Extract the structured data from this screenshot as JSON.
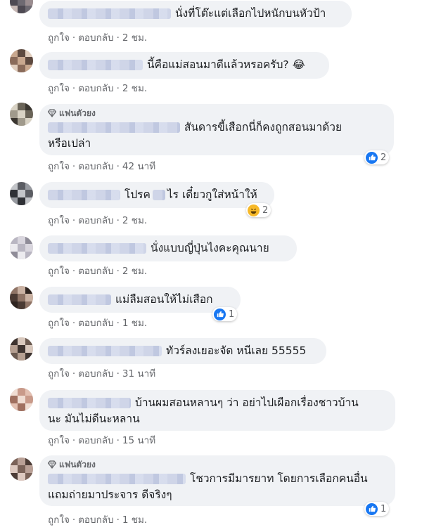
{
  "actions": {
    "like": "ถูกใจ",
    "reply": "ตอบกลับ",
    "dot": "·"
  },
  "badge_label": "แฟนตัวยง",
  "comments": [
    {
      "lines": [
        "นั่งที่โต๊ะแต่เลือกไปหนักบนหัวป้า"
      ],
      "time": "2 ชม."
    },
    {
      "lines": [
        "นี้คือแม่สอนมาดีแล้วหรอครับ?"
      ],
      "emoji": "😂",
      "time": "2 ชม."
    },
    {
      "lines": [
        "สันดารขี้เสือกนี่ก็คงถูกสอนมาด้วย",
        "หรือเปล่า"
      ],
      "time": "42 นาที",
      "reaction": {
        "type": "like",
        "count": "2"
      }
    },
    {
      "lines": [
        "โปรค",
        "ไร เดี๋ยวกูใส่หน้าให้"
      ],
      "time": "2 ชม.",
      "reaction": {
        "type": "haha",
        "count": "2"
      }
    },
    {
      "lines": [
        "นั่งแบบญี่ปุ่นไงคะคุณนาย"
      ],
      "time": "2 ชม."
    },
    {
      "lines": [
        "แม่ลืมสอนให้ไม่เสือก"
      ],
      "time": "1 ชม.",
      "reaction": {
        "type": "like",
        "count": "1"
      }
    },
    {
      "lines": [
        "ทัวร์ลงเยอะจัด หนีเลย 55555"
      ],
      "time": "31 นาที"
    },
    {
      "lines": [
        "บ้านผมสอนหลานๆ ว่า อย่าไปเผือกเรื่องชาวบ้าน",
        "นะ มันไม่ดีนะหลาน"
      ],
      "time": "15 นาที"
    },
    {
      "lines": [
        "โชวการมีมารยาท โดยการเลือกคนอื่น",
        "แถมถ่ายมาประจาร ดีจริงๆ"
      ],
      "time": "1 ชม.",
      "reaction": {
        "type": "like",
        "count": "1"
      }
    }
  ],
  "colors": {
    "bubble": "#f0f2f5",
    "meta": "#65676b",
    "like": "#1877f2",
    "haha": "#f7b928"
  }
}
